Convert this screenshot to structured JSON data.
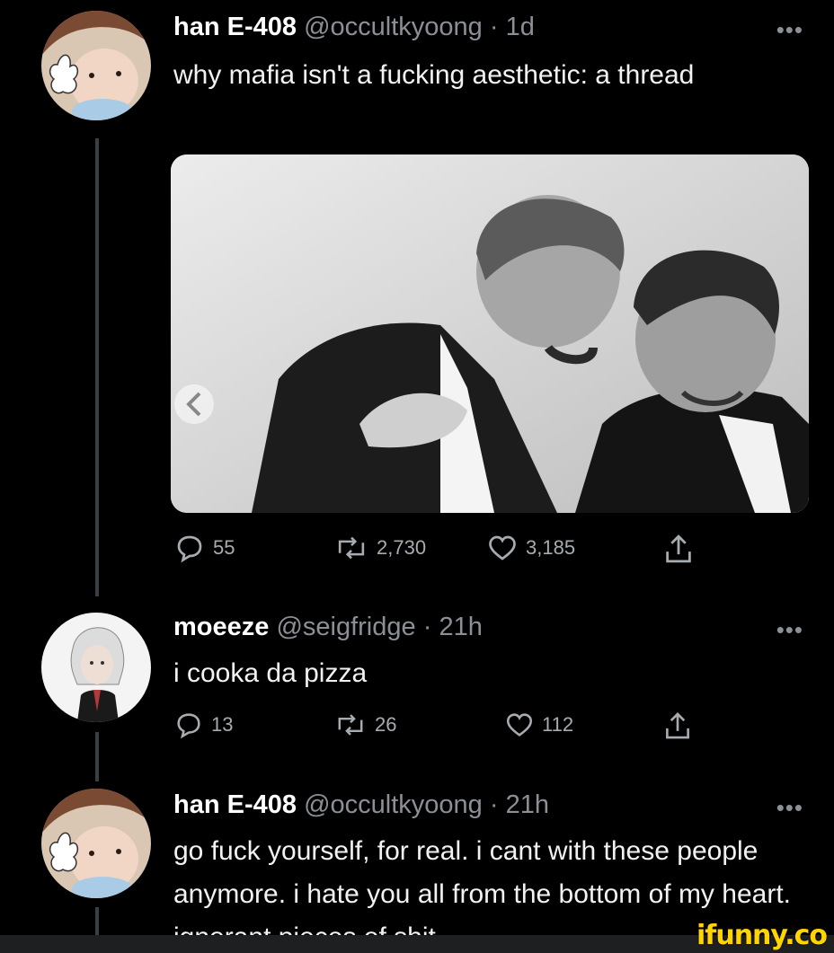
{
  "tweets": [
    {
      "name": "han E-408",
      "handle": "@occultkyoong",
      "separator": "·",
      "time": "1d",
      "more": "•••",
      "text": "why mafia isn't a fucking aesthetic: a thread",
      "media": "photo",
      "reply_count": "55",
      "retweet_count": "2,730",
      "like_count": "3,185"
    },
    {
      "name": "moeeze",
      "handle": "@seigfridge",
      "separator": "·",
      "time": "21h",
      "more": "•••",
      "text": "i cooka da pizza",
      "reply_count": "13",
      "retweet_count": "26",
      "like_count": "112"
    },
    {
      "name": "han E-408",
      "handle": "@occultkyoong",
      "separator": "·",
      "time": "21h",
      "more": "•••",
      "text": "go fuck yourself, for real. i cant with these people anymore. i hate you all from the bottom of my heart. ignorant pieces of shit"
    }
  ],
  "watermark": "ifunny.co",
  "icons": {
    "reply": "reply-icon",
    "retweet": "retweet-icon",
    "like": "heart-icon",
    "share": "share-icon",
    "carousel": "chevron-left-icon"
  },
  "colors": {
    "background": "#000000",
    "text": "#e7e9ea",
    "muted": "#8b9096",
    "watermark": "#ffd400"
  }
}
